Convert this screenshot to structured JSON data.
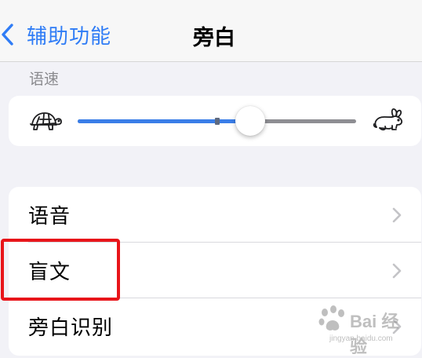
{
  "nav": {
    "back_label": "辅助功能",
    "title": "旁白"
  },
  "speech_rate": {
    "section_label": "语速",
    "slow_icon": "turtle-icon",
    "fast_icon": "rabbit-icon",
    "value": 0.62,
    "default_marker": 0.5,
    "fill_color": "#3a7ee8",
    "track_color": "#8e8e93"
  },
  "settings_list": {
    "items": [
      {
        "label": "语音",
        "icon": "chevron-right-icon"
      },
      {
        "label": "盲文",
        "icon": "chevron-right-icon"
      },
      {
        "label": "旁白识别",
        "icon": "chevron-right-icon"
      }
    ]
  },
  "highlight": {
    "color": "#e8151a"
  },
  "watermark": {
    "brand": "Bai  经验",
    "url": "jingyan.baidu.com"
  },
  "colors": {
    "accent": "#2f7cf6",
    "background": "#f2f2f7"
  }
}
